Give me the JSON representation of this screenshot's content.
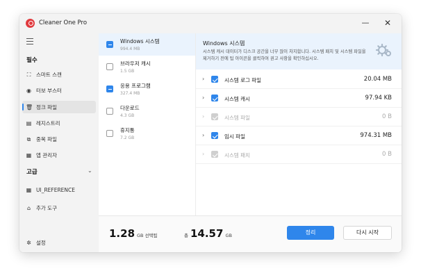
{
  "app": {
    "title": "Cleaner One Pro",
    "minimize_glyph": "—",
    "close_glyph": "✕"
  },
  "sidebar": {
    "section_essential": "필수",
    "items": [
      {
        "label": "스마트 스캔",
        "icon": "scan-icon"
      },
      {
        "label": "터보 부스터",
        "icon": "booster-icon"
      },
      {
        "label": "정크 파일",
        "icon": "trash-icon",
        "active": true
      },
      {
        "label": "레지스트리",
        "icon": "registry-icon"
      },
      {
        "label": "중복 파일",
        "icon": "duplicate-icon"
      },
      {
        "label": "앱 관리자",
        "icon": "apps-icon"
      }
    ],
    "section_advanced": "고급",
    "advanced_items": [
      {
        "label": "UI_REFERENCE",
        "icon": "grid-icon"
      },
      {
        "label": "추가 도구",
        "icon": "toolbox-icon"
      }
    ],
    "settings_label": "설정"
  },
  "categories": [
    {
      "name": "Windows 시스템",
      "size": "994.4 MB",
      "state": "partial",
      "selected": true
    },
    {
      "name": "브라우저 캐시",
      "size": "1.5 GB",
      "state": "unchecked"
    },
    {
      "name": "응용 프로그램",
      "size": "327.4 MB",
      "state": "partial"
    },
    {
      "name": "다운로드",
      "size": "4.3 GB",
      "state": "unchecked"
    },
    {
      "name": "휴지통",
      "size": "7.2 GB",
      "state": "unchecked"
    }
  ],
  "detail": {
    "title": "Windows 시스템",
    "description": "시스템 캐시 데이터가 디스크 공간을 너무 많이 차지합니다. 시스템 패치 및 시스템 파일을 제거하기 전에 팁 아이콘을 클릭하여 권고 사항을 확인하십시오.",
    "rows": [
      {
        "name": "시스템 로그 파일",
        "size": "20.04 MB",
        "state": "checked",
        "enabled": true
      },
      {
        "name": "시스템 캐시",
        "size": "97.94 KB",
        "state": "checked",
        "enabled": true
      },
      {
        "name": "시스템 파일",
        "size": "0 B",
        "state": "disabled",
        "enabled": false
      },
      {
        "name": "임시 파일",
        "size": "974.31 MB",
        "state": "checked",
        "enabled": true
      },
      {
        "name": "시스템 패치",
        "size": "0 B",
        "state": "disabled",
        "enabled": false
      }
    ]
  },
  "footer": {
    "selected_value": "1.28",
    "selected_unit": "GB 선택됨",
    "total_prefix": "총",
    "total_value": "14.57",
    "total_unit": "GB",
    "clean_label": "정리",
    "rescan_label": "다시 시작"
  },
  "colors": {
    "accent": "#2f86eb",
    "logo": "#e03a3e",
    "highlight": "#eaf3fd"
  }
}
